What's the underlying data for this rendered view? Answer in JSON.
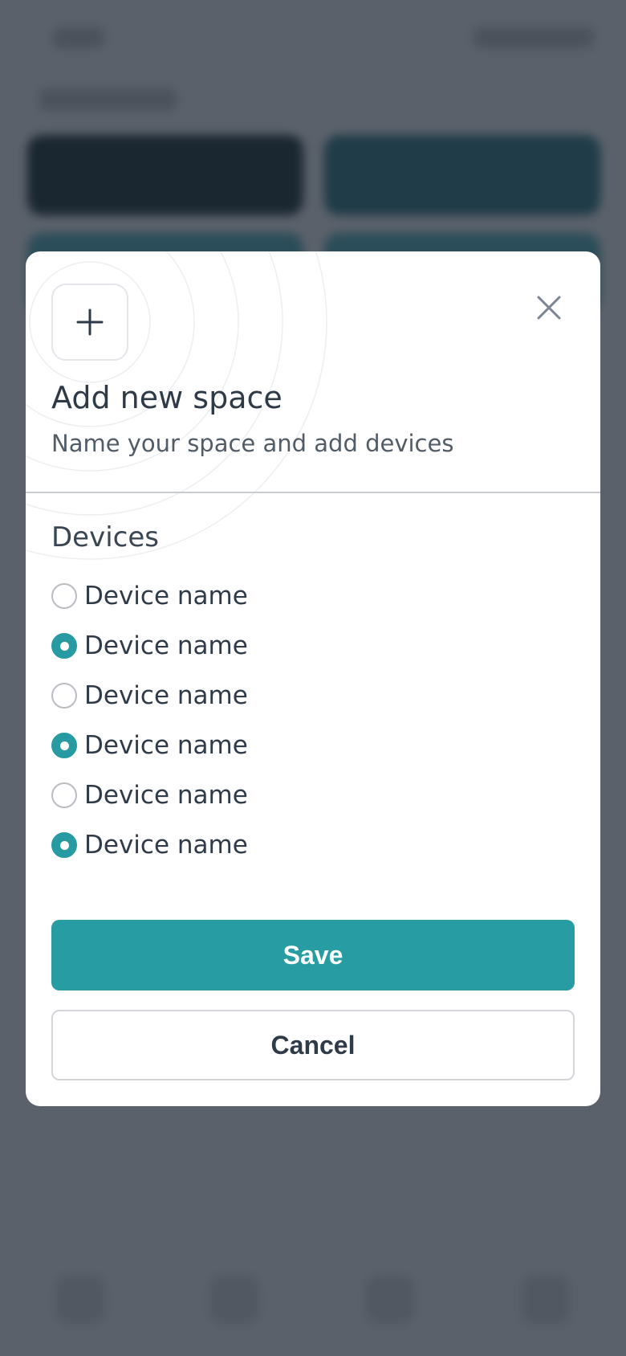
{
  "modal": {
    "title": "Add new space",
    "subtitle": "Name your space and add devices",
    "icon": "plus-icon",
    "close_icon": "close-icon",
    "section_label": "Devices",
    "devices": [
      {
        "label": "Device name",
        "selected": false
      },
      {
        "label": "Device name",
        "selected": true
      },
      {
        "label": "Device name",
        "selected": false
      },
      {
        "label": "Device name",
        "selected": true
      },
      {
        "label": "Device name",
        "selected": false
      },
      {
        "label": "Device name",
        "selected": true
      }
    ],
    "save_label": "Save",
    "cancel_label": "Cancel"
  },
  "colors": {
    "accent": "#279ca3",
    "text_primary": "#2e3a47",
    "overlay": "#5b616b"
  }
}
